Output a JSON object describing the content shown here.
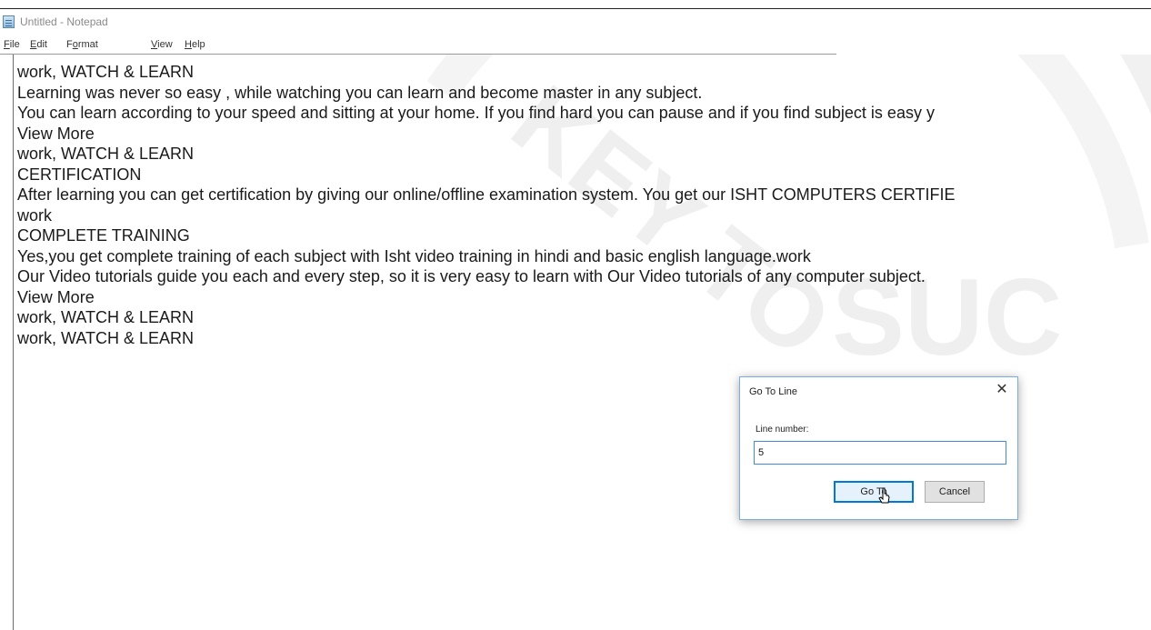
{
  "window": {
    "title": "Untitled - Notepad"
  },
  "menu": [
    {
      "pre": "",
      "mnemonic": "F",
      "post": "ile"
    },
    {
      "pre": "",
      "mnemonic": "E",
      "post": "dit"
    },
    {
      "pre": "F",
      "mnemonic": "o",
      "post": "rmat"
    },
    {
      "pre": "",
      "mnemonic": "V",
      "post": "iew"
    },
    {
      "pre": "",
      "mnemonic": "H",
      "post": "elp"
    }
  ],
  "editor": {
    "lines": [
      "work, WATCH & LEARN",
      "Learning was never so easy , while watching you can learn and become master in any subject.",
      "You can learn according to your speed and sitting at your home. If you find hard you can pause and if you find subject is easy y",
      "View More",
      "work, WATCH & LEARN",
      "CERTIFICATION",
      "After learning you can get certification by giving our online/offline examination system. You get our ISHT COMPUTERS CERTIFIE",
      "work",
      "COMPLETE TRAINING",
      "Yes,you get complete training of each subject with Isht video training in hindi and basic english language.work",
      "Our Video tutorials guide you each and every step, so it is very easy to learn with Our Video tutorials of any computer subject.",
      "View More",
      "work, WATCH & LEARN",
      "work, WATCH & LEARN"
    ]
  },
  "dialog": {
    "title": "Go To Line",
    "close_glyph": "✕",
    "label": "Line number:",
    "value": "5",
    "ok_label": "Go To",
    "cancel_label": "Cancel"
  },
  "watermark": {
    "text_a": "KEY TO",
    "text_b": "SUC",
    "color": "#cfcfcf"
  },
  "colors": {
    "dialog_border": "#7aaede",
    "focus_blue": "#0078d7"
  },
  "icons": {
    "app": "notepad-icon",
    "close": "close-icon",
    "cursor": "mouse-pointer-icon"
  }
}
